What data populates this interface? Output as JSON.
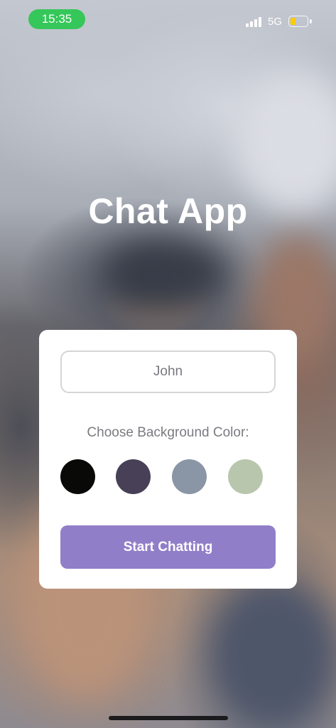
{
  "status_bar": {
    "time": "15:35",
    "network": "5G",
    "battery_level": 0.3
  },
  "title": "Chat App",
  "form": {
    "name_value": "John",
    "color_label": "Choose Background Color:",
    "colors": [
      "#090A08",
      "#474056",
      "#8A95A5",
      "#B9C6AE"
    ],
    "start_label": "Start Chatting"
  },
  "theme": {
    "accent": "#917EC8",
    "status_pill": "#35C759",
    "battery": "#FFCC00"
  }
}
